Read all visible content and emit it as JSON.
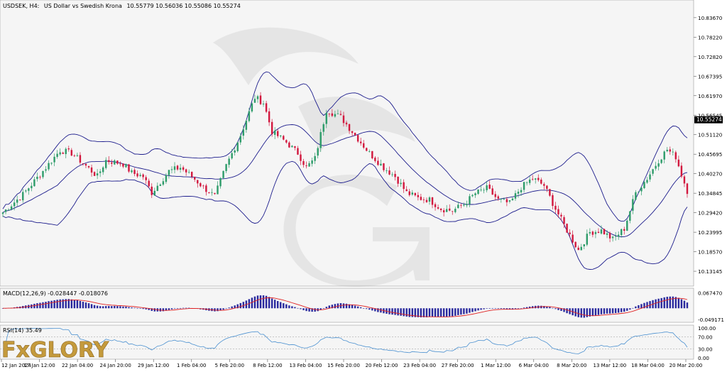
{
  "header": {
    "symbol": "USDSEK, H4:",
    "description": "US Dollar vs Swedish Krona",
    "ohlc": "10.55779 10.56036 10.55086 10.55274"
  },
  "colors": {
    "background": "#ffffff",
    "plot_bg": "#f5f5f5",
    "bull": "#2e9c6a",
    "bear": "#d2183e",
    "bands": "#1c1c8c",
    "macd_hist": "#2a2a9e",
    "macd_signal": "#e02020",
    "rsi_line": "#4a90d0",
    "grid": "#cfcfcf",
    "price_tag_bg": "#000000",
    "price_tag_fg": "#ffffff"
  },
  "chart_data": [
    {
      "type": "candlestick",
      "panel": "main",
      "title": "USDSEK, H4: US Dollar vs Swedish Krona",
      "indicators": [
        "Bollinger Bands"
      ],
      "current_price": 10.55274,
      "current_price_label": "10.55274",
      "ylim": [
        10.1,
        10.87
      ],
      "ytick_labels": [
        "10.83670",
        "10.78220",
        "10.72820",
        "10.67395",
        "10.61970",
        "10.56545",
        "10.51120",
        "10.45695",
        "10.40270",
        "10.34845",
        "10.29420",
        "10.23995",
        "10.18570",
        "10.13145"
      ],
      "x_ticks": [
        "12 Jan 2024",
        "17 Jan 12:00",
        "22 Jan 04:00",
        "24 Jan 20:00",
        "29 Jan 12:00",
        "1 Feb 04:00",
        "5 Feb 20:00",
        "8 Feb 12:00",
        "13 Feb 04:00",
        "15 Feb 20:00",
        "20 Feb 12:00",
        "23 Feb 04:00",
        "27 Feb 20:00",
        "1 Mar 12:00",
        "6 Mar 04:00",
        "8 Mar 20:00",
        "13 Mar 12:00",
        "18 Mar 04:00",
        "20 Mar 20:00"
      ],
      "close_path": [
        [
          0,
          10.295
        ],
        [
          7,
          10.345
        ],
        [
          14,
          10.41
        ],
        [
          20,
          10.468
        ],
        [
          24,
          10.46
        ],
        [
          28,
          10.432
        ],
        [
          33,
          10.395
        ],
        [
          36,
          10.44
        ],
        [
          42,
          10.43
        ],
        [
          45,
          10.405
        ],
        [
          49,
          10.395
        ],
        [
          52,
          10.35
        ],
        [
          58,
          10.41
        ],
        [
          62,
          10.42
        ],
        [
          66,
          10.395
        ],
        [
          70,
          10.365
        ],
        [
          74,
          10.34
        ],
        [
          78,
          10.425
        ],
        [
          83,
          10.51
        ],
        [
          88,
          10.615
        ],
        [
          91,
          10.6
        ],
        [
          94,
          10.52
        ],
        [
          99,
          10.49
        ],
        [
          103,
          10.46
        ],
        [
          106,
          10.42
        ],
        [
          109,
          10.445
        ],
        [
          113,
          10.58
        ],
        [
          118,
          10.56
        ],
        [
          124,
          10.5
        ],
        [
          128,
          10.46
        ],
        [
          133,
          10.42
        ],
        [
          137,
          10.395
        ],
        [
          141,
          10.35
        ],
        [
          145,
          10.335
        ],
        [
          149,
          10.33
        ],
        [
          153,
          10.305
        ],
        [
          157,
          10.3
        ],
        [
          161,
          10.318
        ],
        [
          165,
          10.348
        ],
        [
          169,
          10.362
        ],
        [
          173,
          10.33
        ],
        [
          177,
          10.32
        ],
        [
          181,
          10.365
        ],
        [
          185,
          10.39
        ],
        [
          189,
          10.37
        ],
        [
          193,
          10.305
        ],
        [
          197,
          10.245
        ],
        [
          201,
          10.19
        ],
        [
          205,
          10.24
        ],
        [
          209,
          10.245
        ],
        [
          213,
          10.22
        ],
        [
          217,
          10.25
        ],
        [
          221,
          10.35
        ],
        [
          225,
          10.39
        ],
        [
          229,
          10.44
        ],
        [
          232,
          10.47
        ],
        [
          235,
          10.45
        ],
        [
          237,
          10.4
        ],
        [
          239,
          10.355
        ]
      ],
      "candles": 240
    },
    {
      "type": "histogram+line",
      "panel": "macd",
      "label": "MACD(12,26,9) -0.028447 -0.018076",
      "ytick_labels": [
        "0.067470",
        "-0.049171"
      ],
      "ylim": [
        -0.055,
        0.075
      ]
    },
    {
      "type": "line",
      "panel": "rsi",
      "label": "RSI(14) 35.49",
      "ytick_labels": [
        "100.00",
        "70.00",
        "30.00",
        "0.00"
      ],
      "ylim": [
        0,
        100
      ],
      "levels": [
        70,
        30
      ],
      "last_value": 35.49
    }
  ],
  "logo": {
    "brand": "FxGLORY"
  }
}
